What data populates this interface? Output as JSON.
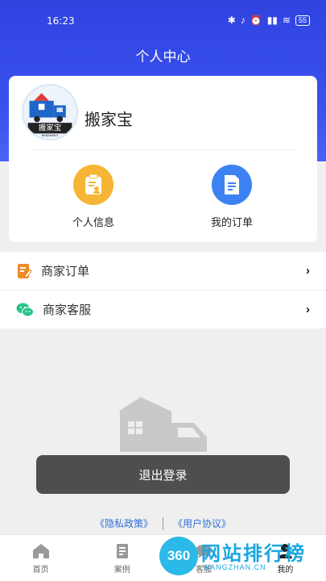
{
  "status_bar": {
    "time": "16:23",
    "battery": "55"
  },
  "header": {
    "title": "个人中心"
  },
  "profile": {
    "username": "搬家宝",
    "avatar_text": "搬家宝",
    "avatar_sub": "BANJIABAO"
  },
  "quick_actions": [
    {
      "label": "个人信息",
      "icon": "profile-doc-icon",
      "color": "#f6b535"
    },
    {
      "label": "我的订单",
      "icon": "order-doc-icon",
      "color": "#3d82f2"
    }
  ],
  "menu": [
    {
      "label": "商家订单",
      "icon": "merchant-order-icon"
    },
    {
      "label": "商家客服",
      "icon": "wechat-service-icon"
    }
  ],
  "logout_label": "退出登录",
  "links": {
    "privacy": "《隐私政策》",
    "agreement": "《用户协议》"
  },
  "tabs": [
    {
      "label": "首页",
      "icon": "home-icon"
    },
    {
      "label": "案例",
      "icon": "cases-icon"
    },
    {
      "label": "客服",
      "icon": "service-icon"
    },
    {
      "label": "我的",
      "icon": "me-icon",
      "active": true
    }
  ],
  "watermark": {
    "circle": "360",
    "text": "网站排行榜",
    "sub": "WANGZHAN.CN"
  },
  "colors": {
    "header": "#2f43e0",
    "logout": "#4e4e4e",
    "link": "#2e6fdc"
  }
}
